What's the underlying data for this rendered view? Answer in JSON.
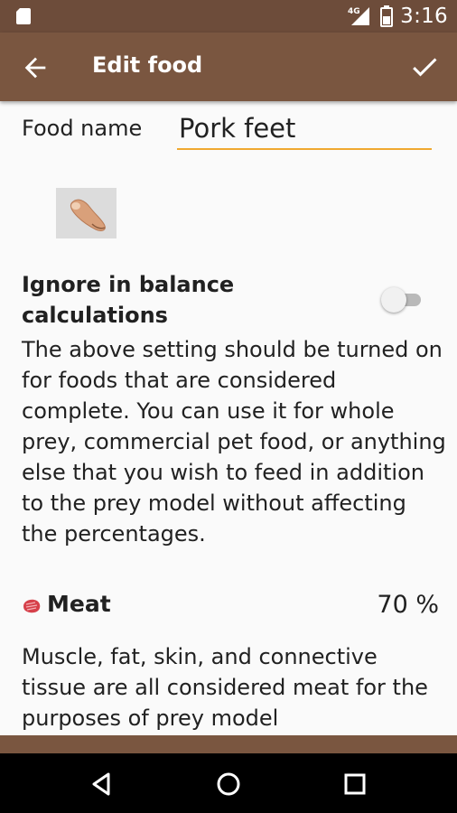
{
  "status_bar": {
    "time": "3:16",
    "network": "4G"
  },
  "app_bar": {
    "title": "Edit food"
  },
  "form": {
    "food_name_label": "Food name",
    "food_name_value": "Pork feet",
    "ignore_label": "Ignore in balance calculations",
    "ignore_enabled": false,
    "explanation": "The above setting should be turned on for foods that are considered complete. You can use it for whole prey, commercial pet food, or anything else that you wish to feed in addition to the prey model without affecting the percentages."
  },
  "meat": {
    "label": "Meat",
    "percent": "70 %",
    "description": "Muscle, fat, skin, and connective tissue are all considered meat for the purposes of prey model"
  },
  "icons": {
    "back": "arrow-back-icon",
    "save": "check-icon",
    "meat": "meat-icon",
    "food_image": "pork-feet-image"
  },
  "colors": {
    "status_bar": "#6d4c3a",
    "app_bar": "#7a5640",
    "accent": "#f0a830",
    "background": "#fafafa"
  }
}
